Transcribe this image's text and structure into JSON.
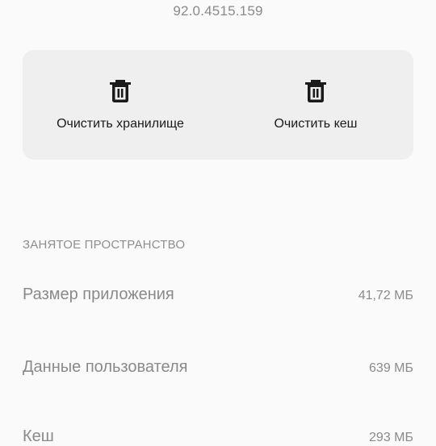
{
  "header": {
    "version": "92.0.4515.159"
  },
  "actions": {
    "clear_storage_label": "Очистить хранилище",
    "clear_cache_label": "Очистить кеш",
    "icon": "trash-icon"
  },
  "storage": {
    "section_title": "ЗАНЯТОЕ ПРОСТРАНСТВО",
    "rows": [
      {
        "label": "Размер приложения",
        "value": "41,72 МБ"
      },
      {
        "label": "Данные пользователя",
        "value": "639 МБ"
      },
      {
        "label": "Кеш",
        "value": "293 МБ"
      }
    ]
  }
}
